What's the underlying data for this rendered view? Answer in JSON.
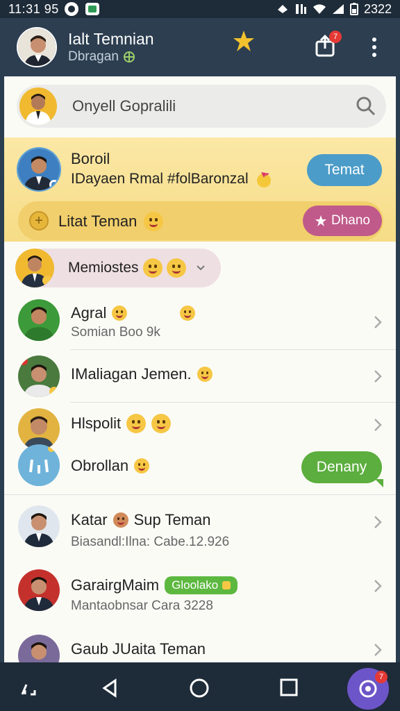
{
  "status_bar": {
    "time": "11:31 95",
    "battery": "2322"
  },
  "header": {
    "title": "Ialt Temnian",
    "subtitle": "Dbragan",
    "share_badge": "7"
  },
  "search": {
    "placeholder": "Onyell Gopralili"
  },
  "highlight": {
    "name": "Boroil",
    "description": "IDayaen Rmal #folBaronzal",
    "action_label": "Temat",
    "bar_label": "Litat Teman",
    "bar_action_label": "Dhano"
  },
  "pill": {
    "label": "Memiostes"
  },
  "contacts": [
    {
      "name": "Agral",
      "sub": "Somian Boo 9k"
    },
    {
      "name": "IMaliagan Jemen.",
      "sub": ""
    },
    {
      "name": "Hlspolit",
      "sub": ""
    },
    {
      "name": "Obrollan",
      "sub": "",
      "action_label": "Denany"
    },
    {
      "name": "Katar",
      "name_suffix": "Sup Teman",
      "sub": "Biasandl:Ilna: Cabe.12.926"
    },
    {
      "name": "GarairgMaim",
      "badge": "Gloolako",
      "sub": "Mantaobnsar Cara 3228"
    },
    {
      "name": "Gaub JUaita Teman",
      "sub": ""
    }
  ],
  "nav": {
    "fab_badge": "7"
  },
  "colors": {
    "header_bg": "#2c3e50",
    "highlight_bg": "#f6dc86",
    "temat_button": "#4b9cc8",
    "dhano_button": "#c05a8a",
    "denany_button": "#5cae3e",
    "fab": "#6c55c8"
  },
  "icons": [
    "star-icon",
    "share-icon",
    "more-icon",
    "search-icon",
    "chevron-right-icon",
    "back-icon",
    "home-icon",
    "recents-icon",
    "chat-fab-icon"
  ]
}
